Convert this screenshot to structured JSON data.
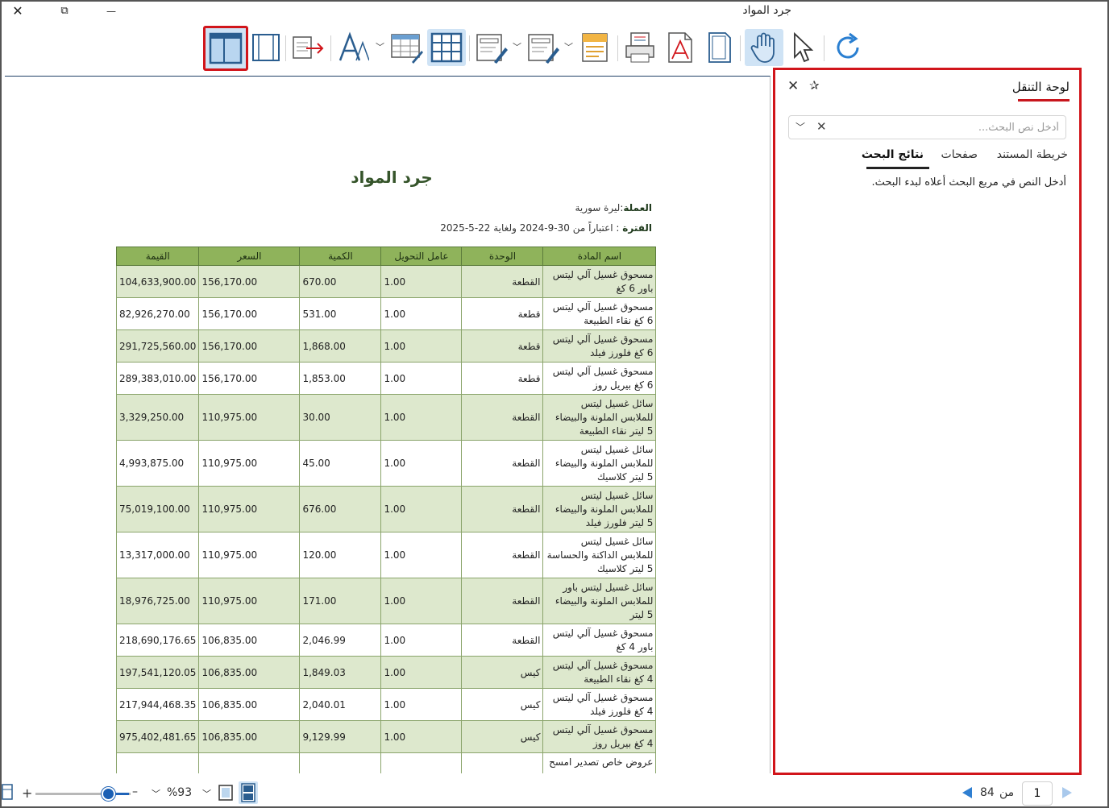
{
  "window": {
    "title": "جرد المواد",
    "close_glyph": "✕",
    "restore_glyph": "⧉",
    "minimize_glyph": "—"
  },
  "toolbar": {
    "tools": [
      {
        "name": "single-page-view",
        "active": true,
        "selected": true
      },
      {
        "name": "page-layout"
      },
      {
        "name": "export"
      },
      {
        "name": "font",
        "dropdown": true
      },
      {
        "name": "edit-table"
      },
      {
        "name": "grid-view",
        "active": true
      },
      {
        "name": "edit-fields",
        "dropdown": true
      },
      {
        "name": "edit-fields-2",
        "dropdown": true
      },
      {
        "name": "document-template"
      },
      {
        "name": "print"
      },
      {
        "name": "pdf"
      },
      {
        "name": "page-setup"
      },
      {
        "name": "hand-tool",
        "active": true
      },
      {
        "name": "select-tool"
      },
      {
        "name": "refresh"
      }
    ]
  },
  "report": {
    "title": "جرد المواد",
    "currency_label": "العملة",
    "currency_value": ":ليرة سورية",
    "period_label": "الفترة",
    "period_value": " : اعتباراً من 30-9-2024 ولغاية 22-5-2025",
    "columns": [
      "اسم المادة",
      "الوحدة",
      "عامل التحويل",
      "الكمية",
      "السعر",
      "القيمة"
    ],
    "rows": [
      {
        "name": [
          "مسحوق غسيل آلي ليتس",
          "باور 6 كغ"
        ],
        "unit": "القطعة",
        "factor": "1.00",
        "qty": "670.00",
        "price": "156,170.00",
        "value": "104,633,900.00"
      },
      {
        "name": [
          "مسحوق غسيل آلي ليتس",
          "6 كغ نقاء الطبيعة"
        ],
        "unit": "قطعة",
        "factor": "1.00",
        "qty": "531.00",
        "price": "156,170.00",
        "value": "82,926,270.00"
      },
      {
        "name": [
          "مسحوق غسيل آلي ليتس",
          "6 كغ فلورز فيلد"
        ],
        "unit": "قطعة",
        "factor": "1.00",
        "qty": "1,868.00",
        "price": "156,170.00",
        "value": "291,725,560.00"
      },
      {
        "name": [
          "مسحوق غسيل آلي ليتس",
          "6 كغ بيريل روز"
        ],
        "unit": "قطعة",
        "factor": "1.00",
        "qty": "1,853.00",
        "price": "156,170.00",
        "value": "289,383,010.00"
      },
      {
        "name": [
          "سائل غسيل ليتس",
          "للملابس الملونة والبيضاء",
          "5 ليتر نقاء الطبيعة"
        ],
        "unit": "القطعة",
        "factor": "1.00",
        "qty": "30.00",
        "price": "110,975.00",
        "value": "3,329,250.00"
      },
      {
        "name": [
          "سائل غسيل ليتس",
          "للملابس الملونة والبيضاء",
          "5 ليتر كلاسيك"
        ],
        "unit": "القطعة",
        "factor": "1.00",
        "qty": "45.00",
        "price": "110,975.00",
        "value": "4,993,875.00"
      },
      {
        "name": [
          "سائل غسيل ليتس",
          "للملابس الملونة والبيضاء",
          "5 ليتر فلورز فيلد"
        ],
        "unit": "القطعة",
        "factor": "1.00",
        "qty": "676.00",
        "price": "110,975.00",
        "value": "75,019,100.00"
      },
      {
        "name": [
          "سائل غسيل ليتس",
          "للملابس الداكنة والحساسة",
          "5 ليتر كلاسيك"
        ],
        "unit": "القطعة",
        "factor": "1.00",
        "qty": "120.00",
        "price": "110,975.00",
        "value": "13,317,000.00"
      },
      {
        "name": [
          "سائل غسيل ليتس باور",
          "للملابس الملونة والبيضاء",
          "5 ليتر"
        ],
        "unit": "القطعة",
        "factor": "1.00",
        "qty": "171.00",
        "price": "110,975.00",
        "value": "18,976,725.00"
      },
      {
        "name": [
          "مسحوق غسيل آلي ليتس",
          "باور 4 كغ"
        ],
        "unit": "القطعة",
        "factor": "1.00",
        "qty": "2,046.99",
        "price": "106,835.00",
        "value": "218,690,176.65"
      },
      {
        "name": [
          "مسحوق غسيل آلي ليتس",
          "4 كغ نقاء الطبيعة"
        ],
        "unit": "كيس",
        "factor": "1.00",
        "qty": "1,849.03",
        "price": "106,835.00",
        "value": "197,541,120.05"
      },
      {
        "name": [
          "مسحوق غسيل آلي ليتس",
          "4 كغ فلورز فيلد"
        ],
        "unit": "كيس",
        "factor": "1.00",
        "qty": "2,040.01",
        "price": "106,835.00",
        "value": "217,944,468.35"
      },
      {
        "name": [
          "مسحوق غسيل آلي ليتس",
          "4 كغ بيريل روز"
        ],
        "unit": "كيس",
        "factor": "1.00",
        "qty": "9,129.99",
        "price": "106,835.00",
        "value": "975,402,481.65"
      },
      {
        "name": [
          "عروض خاص تصدير امسح",
          ""
        ],
        "unit": "",
        "factor": "",
        "qty": "",
        "price": "",
        "value": ""
      }
    ]
  },
  "nav_panel": {
    "title": "لوحة التنقل",
    "close_glyph": "✕",
    "pin_glyph": "✰",
    "search_placeholder": "أدخل نص البحث...",
    "search_clear_glyph": "✕",
    "search_dropdown_glyph": "﹀",
    "tabs": [
      "خريطة المستند",
      "صفحات",
      "نتائج البحث"
    ],
    "active_tab": "نتائج البحث",
    "hint": "أدخل النص في مربع البحث أعلاه لبدء البحث."
  },
  "status_bar": {
    "zoom_plus": "+",
    "zoom_minus": "–",
    "zoom_value": "%93",
    "zoom_level": 0.7,
    "dropdown_glyph": "﹀",
    "page_current": "1",
    "page_of": "من",
    "page_total": "84"
  },
  "colors": {
    "accent_red": "#d1151b",
    "header_green": "#8fb35b",
    "row_alt_green": "#dde8cd",
    "title_green": "#35542a",
    "zoom_blue": "#1a5fb4"
  }
}
